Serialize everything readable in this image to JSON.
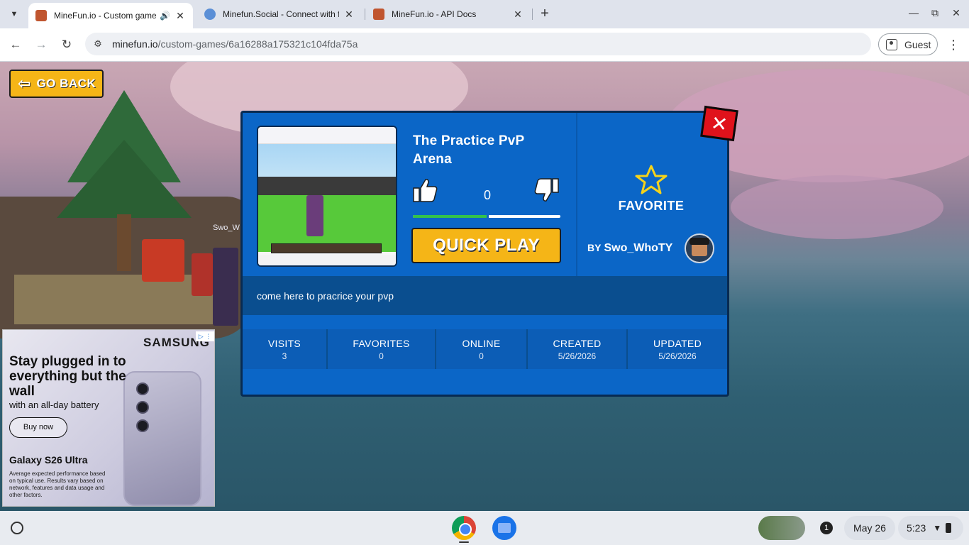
{
  "browser": {
    "tabs": [
      {
        "title": "MineFun.io - Custom game",
        "active": true,
        "audio": true
      },
      {
        "title": "Minefun.Social - Connect with f",
        "active": false
      },
      {
        "title": "MineFun.io - API Docs",
        "active": false
      }
    ],
    "url_host": "minefun.io",
    "url_path": "/custom-games/6a16288a175321c104fda75a",
    "profile_label": "Guest",
    "icons": {
      "tab_menu": "chevron-down-icon",
      "new_tab": "plus-icon",
      "back": "arrow-left-icon",
      "forward": "arrow-right-icon",
      "reload": "reload-icon",
      "site_info": "tune-icon",
      "menu": "kebab-icon"
    }
  },
  "game": {
    "go_back_label": "GO BACK",
    "player_tag": "Swo_W",
    "modal": {
      "title": "The Practice PvP Arena",
      "vote_count": "0",
      "vote_ratio": 0.5,
      "quick_play_label": "QUICK PLAY",
      "favorite_label": "FAVORITE",
      "by_label": "BY",
      "author": "Swo_WhoTY",
      "description": "come here to pracrice your pvp",
      "stats": [
        {
          "label": "VISITS",
          "value": "3"
        },
        {
          "label": "FAVORITES",
          "value": "0"
        },
        {
          "label": "ONLINE",
          "value": "0"
        },
        {
          "label": "CREATED",
          "value": "5/26/2026"
        },
        {
          "label": "UPDATED",
          "value": "5/26/2026"
        }
      ]
    }
  },
  "ad": {
    "brand": "SAMSUNG",
    "headline": "Stay plugged in to everything but the wall",
    "subline": "with an all-day battery",
    "cta": "Buy now",
    "model": "Galaxy S26 Ultra",
    "fine_print": "Average expected performance based on typical use. Results vary based on network, features and data usage and other factors."
  },
  "shelf": {
    "date": "May 26",
    "time": "5:23",
    "notification_count": "1"
  },
  "colors": {
    "modal_blue": "#0b66c7",
    "accent_yellow": "#f5b517",
    "close_red": "#e0121b",
    "vote_green": "#34c24b"
  }
}
